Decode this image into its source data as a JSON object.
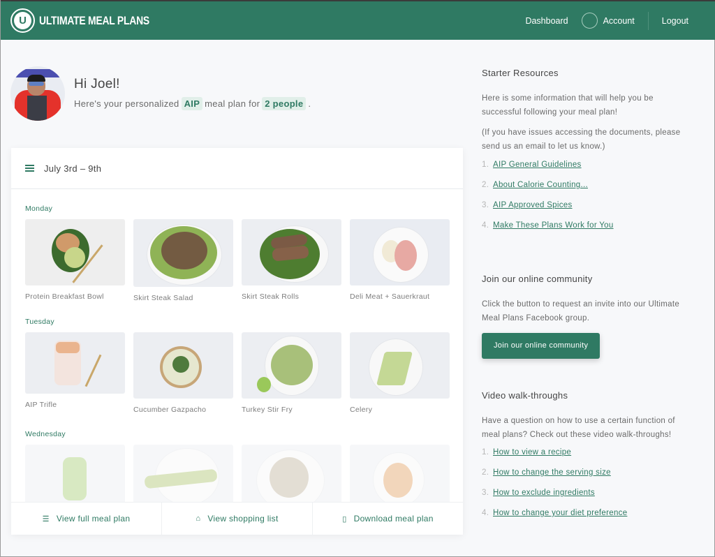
{
  "header": {
    "brand": "ULTIMATE MEAL PLANS",
    "logo_letter": "U",
    "nav": {
      "dashboard": "Dashboard",
      "account": "Account",
      "logout": "Logout"
    },
    "brand_color": "#2f7a63"
  },
  "greeting": {
    "title": "Hi Joel!",
    "prefix": "Here's your personalized",
    "diet": "AIP",
    "middle": "meal plan for",
    "people": "2 people",
    "suffix": "."
  },
  "plan": {
    "title": "July 3rd – 9th",
    "days": [
      {
        "label": "Monday",
        "meals": [
          "Protein Breakfast Bowl",
          "Skirt Steak Salad",
          "Skirt Steak Rolls",
          "Deli Meat + Sauerkraut"
        ]
      },
      {
        "label": "Tuesday",
        "meals": [
          "AIP Trifle",
          "Cucumber Gazpacho",
          "Turkey Stir Fry",
          "Celery"
        ]
      },
      {
        "label": "Wednesday",
        "meals": [
          "",
          "",
          "",
          ""
        ]
      }
    ],
    "footer": {
      "full_plan": "View full meal plan",
      "shopping": "View shopping list",
      "download": "Download meal plan"
    }
  },
  "sidebar": {
    "starter": {
      "title": "Starter Resources",
      "p1": "Here is some information that will help you be successful following your meal plan!",
      "p2": "(If you have issues accessing the documents, please send us an email to let us know.)",
      "links": [
        "AIP General Guidelines",
        "About Calorie Counting...",
        "AIP Approved Spices",
        "Make These Plans Work for You"
      ]
    },
    "community": {
      "title": "Join our online community",
      "p": "Click the button to request an invite into our Ultimate Meal Plans Facebook group.",
      "button": "Join our online community"
    },
    "videos": {
      "title": "Video walk-throughs",
      "p": "Have a question on how to use a certain function of meal plans? Check out these video walk-throughs!",
      "links": [
        "How to view a recipe",
        "How to change the serving size",
        "How to exclude ingredients",
        "How to change your diet preference"
      ]
    }
  }
}
